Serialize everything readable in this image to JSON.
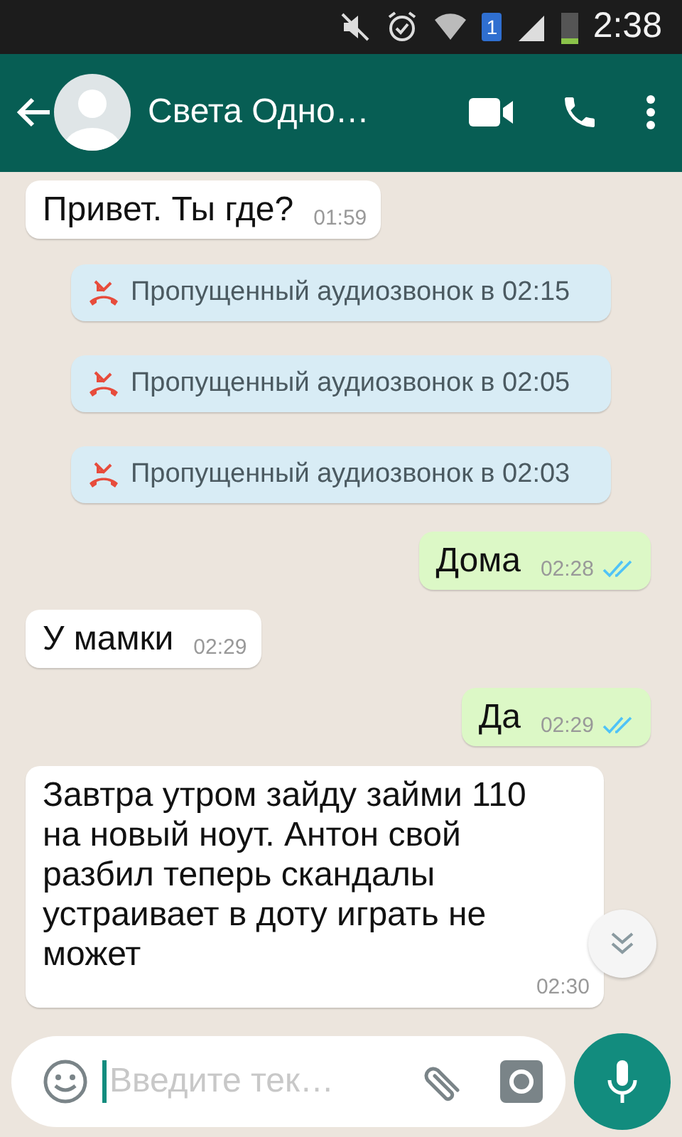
{
  "status_bar": {
    "sim": "1",
    "time": "2:38"
  },
  "header": {
    "contact_name": "Света Одно…"
  },
  "messages": [
    {
      "kind": "in",
      "text": "Привет. Ты где?",
      "time": "01:59"
    },
    {
      "kind": "call",
      "text": "Пропущенный аудиозвонок в 02:15"
    },
    {
      "kind": "call",
      "text": "Пропущенный аудиозвонок в 02:05"
    },
    {
      "kind": "call",
      "text": "Пропущенный аудиозвонок в 02:03"
    },
    {
      "kind": "out",
      "text": "Дома",
      "time": "02:28",
      "read": true
    },
    {
      "kind": "in",
      "text": "У мамки",
      "time": "02:29"
    },
    {
      "kind": "out",
      "text": "Да",
      "time": "02:29",
      "read": true
    },
    {
      "kind": "in",
      "text": "Завтра утром зайду займи 110 на новый ноут. Антон свой разбил теперь скандалы устраивает в доту играть не может",
      "time": "02:30"
    }
  ],
  "composer": {
    "placeholder": "Введите тек…"
  }
}
